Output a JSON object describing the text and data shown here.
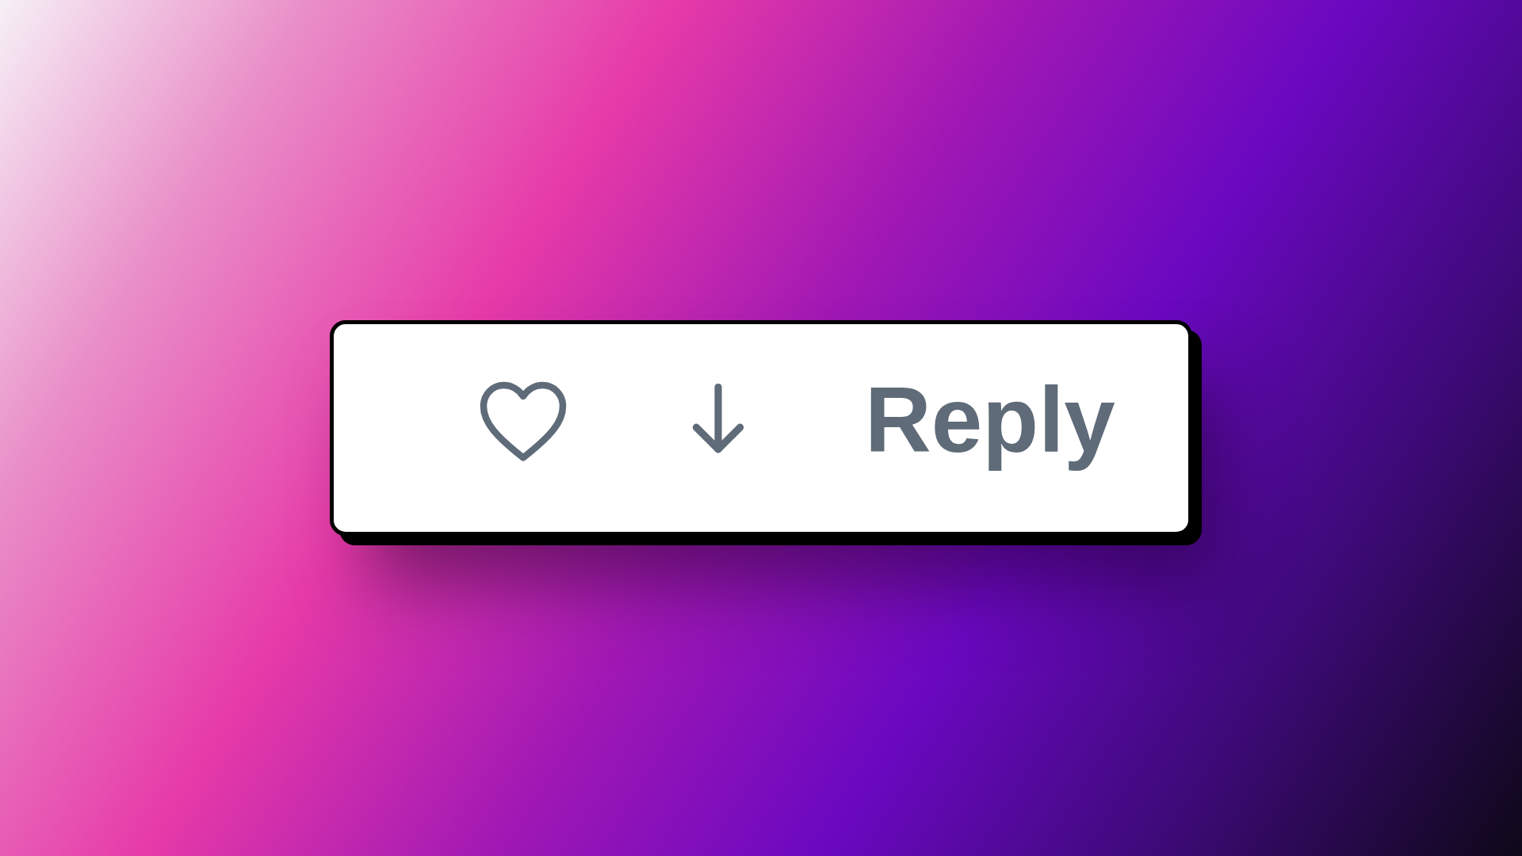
{
  "actions": [
    {
      "kind": "like"
    },
    {
      "kind": "download"
    },
    {
      "kind": "reply",
      "label": "Reply"
    }
  ]
}
